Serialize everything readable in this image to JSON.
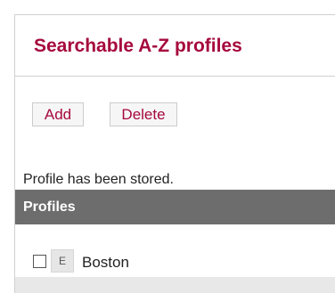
{
  "header": {
    "title": "Searchable A-Z profiles"
  },
  "toolbar": {
    "add_label": "Add",
    "delete_label": "Delete"
  },
  "status": {
    "message": "Profile has been stored."
  },
  "profiles": {
    "header": "Profiles",
    "items": [
      {
        "edit_label": "E",
        "name": "Boston",
        "checked": false
      }
    ]
  },
  "colors": {
    "accent": "#a6093d",
    "section_header_bg": "#6d6d6d",
    "button_bg": "#f6f6f6",
    "edit_button_bg": "#e6e6e6",
    "footer_band": "#e8e8e8"
  }
}
